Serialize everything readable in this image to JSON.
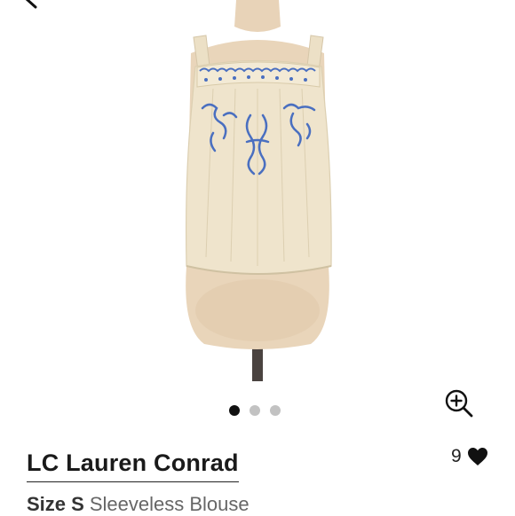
{
  "product": {
    "brand": "LC Lauren Conrad",
    "size_label": "Size S",
    "category": "Sleeveless Blouse",
    "likes": "9"
  },
  "carousel": {
    "total_images": 3,
    "active_index": 0
  },
  "icons": {
    "back": "chevron-left-icon",
    "zoom": "zoom-in-icon",
    "like": "heart-icon"
  },
  "colors": {
    "garment": "#efe4cc",
    "embroidery": "#4a6fc0",
    "mannequin": "#e8d3b8",
    "dot_active": "#111111",
    "dot_inactive": "#c2c2c2"
  }
}
